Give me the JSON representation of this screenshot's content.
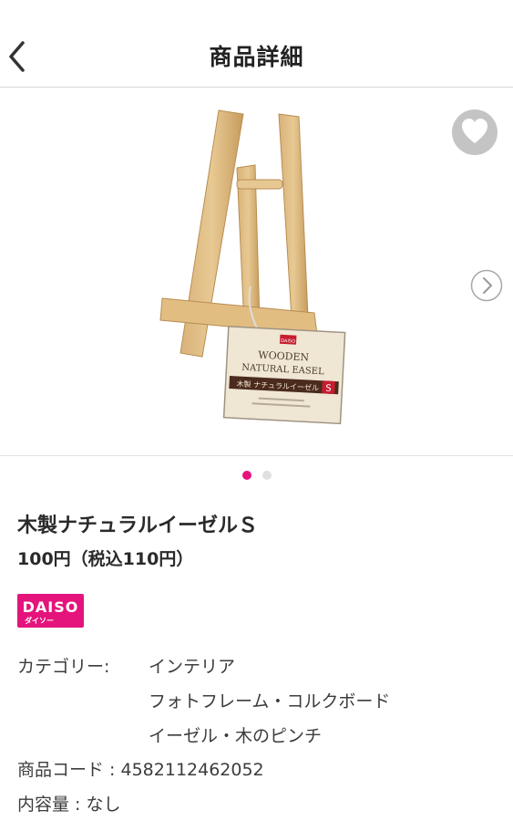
{
  "header": {
    "title": "商品詳細"
  },
  "gallery": {
    "tag_brand": "DAISO",
    "tag_line1": "WOODEN",
    "tag_line2": "NATURAL EASEL",
    "tag_jp": "木製 ナチュラルイーゼル",
    "tag_size": "S",
    "active_index": 0,
    "count": 2
  },
  "product": {
    "name": "木製ナチュラルイーゼルＳ",
    "price": "100円（税込110円）",
    "brand_logo": "DAISO",
    "brand_logo_sub": "ダイソー"
  },
  "details": {
    "category_label": "カテゴリー:",
    "categories": [
      "インテリア",
      "フォトフレーム・コルクボード",
      "イーゼル・木のピンチ"
    ],
    "code_label": "商品コード",
    "code_value": "4582112462052",
    "volume_label": "内容量",
    "volume_value": "なし"
  },
  "colors": {
    "accent": "#e8127c",
    "favorite_bg": "#c4c4c4"
  },
  "icons": {
    "back": "chevron-left-icon",
    "favorite": "heart-icon",
    "next": "chevron-right-circle-icon"
  }
}
